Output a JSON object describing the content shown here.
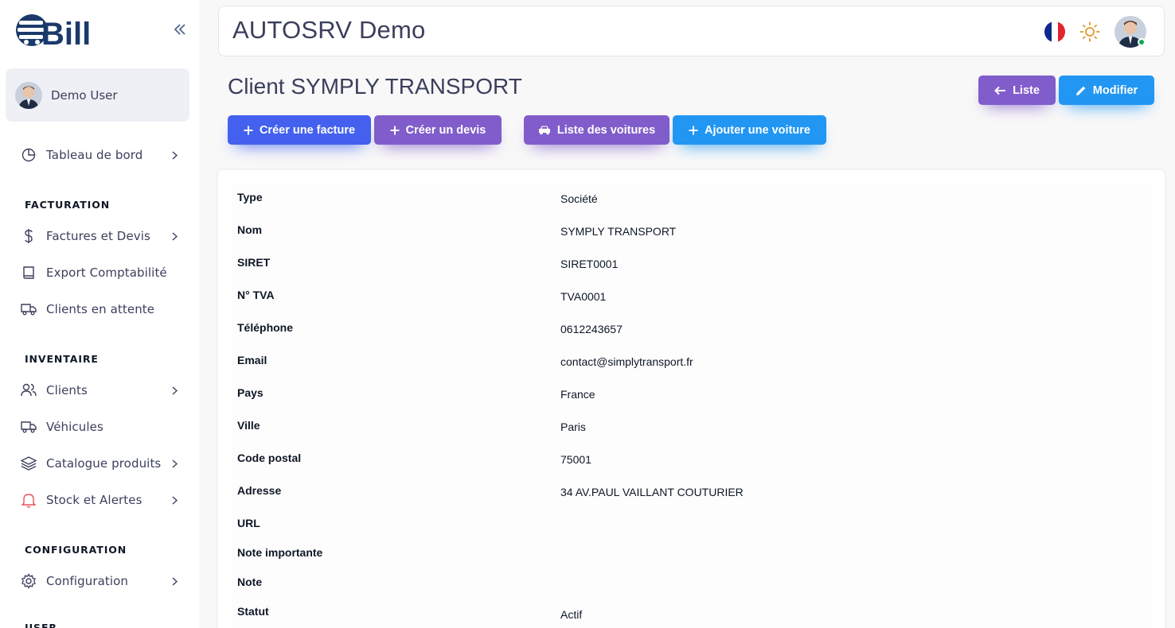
{
  "sidebar": {
    "logo_text": "Bill",
    "user_name": "Demo User",
    "items": [
      {
        "label": "Tableau de bord"
      },
      {
        "label": "Factures et Devis"
      },
      {
        "label": "Export Comptabilité"
      },
      {
        "label": "Clients en attente"
      },
      {
        "label": "Clients"
      },
      {
        "label": "Véhicules"
      },
      {
        "label": "Catalogue produits"
      },
      {
        "label": "Stock et Alertes"
      },
      {
        "label": "Configuration"
      }
    ],
    "sections": {
      "facturation": "FACTURATION",
      "inventaire": "INVENTAIRE",
      "configuration": "CONFIGURATION",
      "user": "USER"
    }
  },
  "header": {
    "title": "AUTOSRV Demo"
  },
  "page": {
    "title": "Client SYMPLY TRANSPORT",
    "buttons": {
      "liste": "Liste",
      "modifier": "Modifier",
      "creer_facture": "Créer une facture",
      "creer_devis": "Créer un devis",
      "liste_voitures": "Liste des voitures",
      "ajouter_voiture": "Ajouter une voiture"
    }
  },
  "details": [
    {
      "label": "Type",
      "value": "Société"
    },
    {
      "label": "Nom",
      "value": "SYMPLY TRANSPORT"
    },
    {
      "label": "SIRET",
      "value": "SIRET0001"
    },
    {
      "label": "N° TVA",
      "value": "TVA0001"
    },
    {
      "label": "Téléphone",
      "value": "0612243657"
    },
    {
      "label": "Email",
      "value": "contact@simplytransport.fr"
    },
    {
      "label": "Pays",
      "value": "France"
    },
    {
      "label": "Ville",
      "value": "Paris"
    },
    {
      "label": "Code postal",
      "value": "75001"
    },
    {
      "label": "Adresse",
      "value": "34 AV.PAUL VAILLANT COUTURIER"
    },
    {
      "label": "URL",
      "value": ""
    },
    {
      "label": "Note importante",
      "value": ""
    },
    {
      "label": "Note",
      "value": ""
    },
    {
      "label": "Statut",
      "value": "Actif"
    }
  ],
  "colors": {
    "primary": "#4361ee",
    "secondary": "#805dca",
    "info": "#2196f3",
    "online": "#00ab55"
  }
}
